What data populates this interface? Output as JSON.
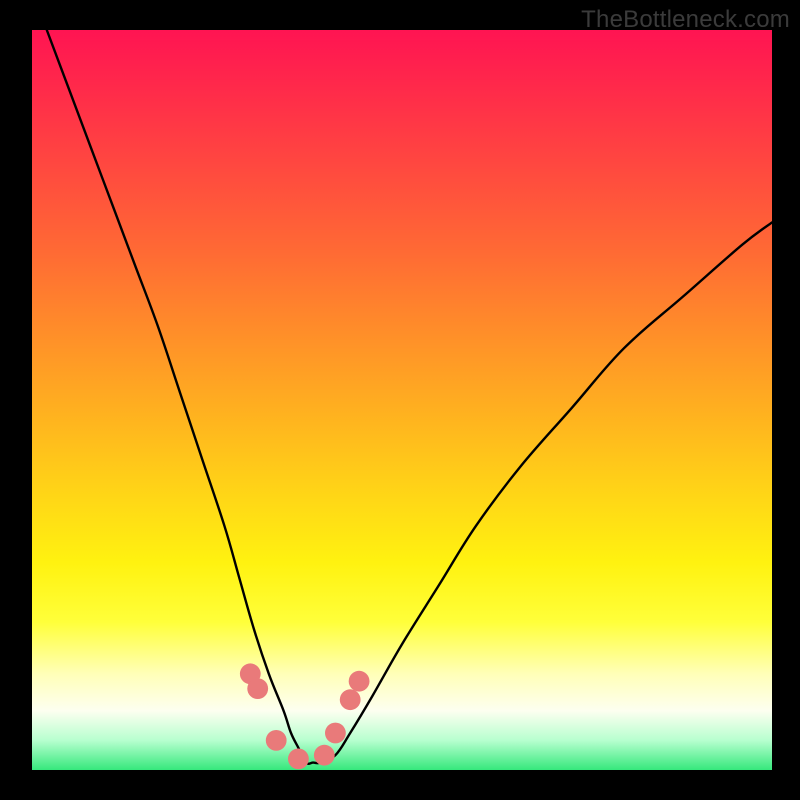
{
  "watermark": "TheBottleneck.com",
  "chart_data": {
    "type": "line",
    "title": "",
    "xlabel": "",
    "ylabel": "",
    "xlim": [
      0,
      100
    ],
    "ylim": [
      0,
      100
    ],
    "grid": false,
    "legend": {
      "show": false
    },
    "series": [
      {
        "name": "bottleneck-curve",
        "color": "#000000",
        "x": [
          2,
          5,
          8,
          11,
          14,
          17,
          20,
          23,
          26,
          28,
          30,
          32,
          34,
          35,
          36,
          37,
          38,
          39,
          41,
          43,
          46,
          50,
          55,
          60,
          66,
          73,
          80,
          88,
          96,
          100
        ],
        "values": [
          100,
          92,
          84,
          76,
          68,
          60,
          51,
          42,
          33,
          26,
          19,
          13,
          8,
          5,
          3,
          1,
          1,
          1,
          2,
          5,
          10,
          17,
          25,
          33,
          41,
          49,
          57,
          64,
          71,
          74
        ]
      }
    ],
    "overlay_points": {
      "name": "marker-dots",
      "color": "#e97a7a",
      "radius_pct": 1.4,
      "x": [
        29.5,
        30.5,
        33,
        36,
        39.5,
        41,
        43,
        44.2
      ],
      "values": [
        13,
        11,
        4,
        1.5,
        2,
        5,
        9.5,
        12
      ]
    },
    "gradient_background": {
      "stops": [
        {
          "pos": 0.0,
          "color": "#ff1452"
        },
        {
          "pos": 0.3,
          "color": "#ff6a34"
        },
        {
          "pos": 0.55,
          "color": "#ffc81c"
        },
        {
          "pos": 0.78,
          "color": "#fff210"
        },
        {
          "pos": 0.92,
          "color": "#fdfff0"
        },
        {
          "pos": 1.0,
          "color": "#36e87c"
        }
      ]
    }
  }
}
